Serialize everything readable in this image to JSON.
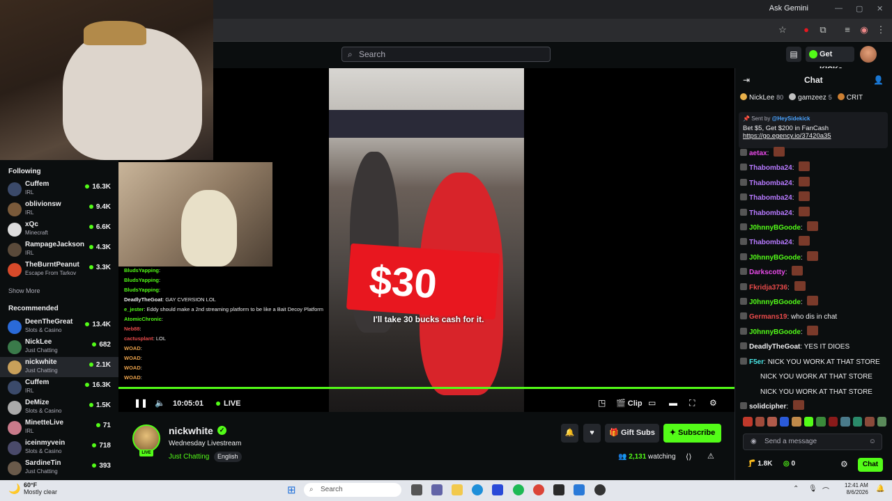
{
  "browser": {
    "ask_gemini": "Ask Gemini"
  },
  "header": {
    "search_placeholder": "Search",
    "get_kicks": "Get KICKs"
  },
  "sidebar": {
    "following_heading": "Following",
    "following": [
      {
        "name": "Cuffem",
        "category": "IRL",
        "viewers": "16.3K",
        "color": "#3b4a6a"
      },
      {
        "name": "oblivionsw",
        "category": "IRL",
        "viewers": "9.4K",
        "color": "#7a5a3a"
      },
      {
        "name": "xQc",
        "category": "Minecraft",
        "viewers": "6.6K",
        "color": "#ddd"
      },
      {
        "name": "RampageJackson",
        "category": "IRL",
        "viewers": "4.3K",
        "color": "#5a4a3a"
      },
      {
        "name": "TheBurntPeanut",
        "category": "Escape From Tarkov",
        "viewers": "3.3K",
        "color": "#d84a2a"
      }
    ],
    "show_more": "Show More",
    "recommended_heading": "Recommended",
    "recommended": [
      {
        "name": "DeenTheGreat",
        "category": "Slots & Casino",
        "viewers": "13.4K",
        "color": "#2a6ad8"
      },
      {
        "name": "NickLee",
        "category": "Just Chatting",
        "viewers": "682",
        "color": "#3a7a4a"
      },
      {
        "name": "nickwhite",
        "category": "Just Chatting",
        "viewers": "2.1K",
        "color": "#c9a05a"
      },
      {
        "name": "Cuffem",
        "category": "IRL",
        "viewers": "16.3K",
        "color": "#3b4a6a"
      },
      {
        "name": "DeMize",
        "category": "Slots & Casino",
        "viewers": "1.5K",
        "color": "#aaa"
      },
      {
        "name": "MinetteLive",
        "category": "IRL",
        "viewers": "71",
        "color": "#c97a8a"
      },
      {
        "name": "iceinmyvein",
        "category": "Slots & Casino",
        "viewers": "718",
        "color": "#4a4a6a"
      },
      {
        "name": "SardineTin",
        "category": "Just Chatting",
        "viewers": "393",
        "color": "#6a5a4a"
      }
    ]
  },
  "player": {
    "price": "$30",
    "caption": "I'll take 30 bucks cash for it.",
    "time": "10:05:01",
    "live": "LIVE",
    "clip": "Clip",
    "progress_fraction": 1.0,
    "overlay_chat": [
      {
        "user": "BludsYapping",
        "text": "",
        "color": "#53fc18"
      },
      {
        "user": "BludsYapping",
        "text": "",
        "color": "#53fc18"
      },
      {
        "user": "BludsYapping",
        "text": "",
        "color": "#53fc18"
      },
      {
        "user": "DeadlyTheGoat",
        "text": "GAY CVERSION LOL",
        "color": "#efeff1"
      },
      {
        "user": "e_jester",
        "text": "Eddy should make a 2nd streaming platform to be like a Bait Decoy Platform",
        "color": "#53fc18"
      },
      {
        "user": "AtomicChronic",
        "text": "",
        "color": "#53fc18"
      },
      {
        "user": "Neb88",
        "text": "",
        "color": "#e84a4a"
      },
      {
        "user": "cactusplant",
        "text": "LOL",
        "color": "#e84a4a"
      },
      {
        "user": "WOAD",
        "text": "",
        "color": "#e8a04a"
      },
      {
        "user": "WOAD",
        "text": "",
        "color": "#e8a04a"
      },
      {
        "user": "WOAD",
        "text": "",
        "color": "#e8a04a"
      },
      {
        "user": "WOAD",
        "text": "",
        "color": "#e8a04a"
      }
    ]
  },
  "stream": {
    "streamer": "nickwhite",
    "live_badge": "LIVE",
    "title": "Wednesday Livestream",
    "category": "Just Chatting",
    "language": "English",
    "gift_subs": "Gift Subs",
    "subscribe": "Subscribe",
    "watching_count": "2,131",
    "watching_label": "watching"
  },
  "chat": {
    "title": "Chat",
    "leaders": [
      {
        "name": "NickLee",
        "score": "80",
        "color": "#e8b04a"
      },
      {
        "name": "gamzeez",
        "score": "5",
        "color": "#c0c0c0"
      },
      {
        "name": "CRIT",
        "score": "",
        "color": "#cd7f32"
      }
    ],
    "pinned_sent_by": "Sent by",
    "pinned_sender": "@HeySidekick",
    "pinned_message": "Bet $5, Get $200 in FanCash",
    "pinned_link": "https://go.egency.io/37420a35",
    "messages": [
      {
        "user": "aetax",
        "text": "",
        "color": "#e84ae8"
      },
      {
        "user": "Thabomba24",
        "text": "",
        "color": "#b77aff"
      },
      {
        "user": "Thabomba24",
        "text": "",
        "color": "#b77aff"
      },
      {
        "user": "Thabomba24",
        "text": "",
        "color": "#b77aff"
      },
      {
        "user": "Thabomba24",
        "text": "",
        "color": "#b77aff"
      },
      {
        "user": "J0hnnyBGoode",
        "text": "",
        "color": "#53fc18"
      },
      {
        "user": "Thabomba24",
        "text": "",
        "color": "#b77aff"
      },
      {
        "user": "J0hnnyBGoode",
        "text": "",
        "color": "#53fc18"
      },
      {
        "user": "Darkscotty",
        "text": "",
        "color": "#e84ae8"
      },
      {
        "user": "Fkridja3736",
        "text": "",
        "color": "#e84a4a"
      },
      {
        "user": "J0hnnyBGoode",
        "text": "",
        "color": "#53fc18"
      },
      {
        "user": "Germans19",
        "text": "who dis in chat",
        "color": "#e84a4a"
      },
      {
        "user": "J0hnnyBGoode",
        "text": "",
        "color": "#53fc18"
      },
      {
        "user": "DeadlyTheGoat",
        "text": "YES IT DIOES",
        "color": "#efeff1"
      },
      {
        "user": "F5er",
        "text": "NICK YOU WORK AT THAT STORE",
        "color": "#4ae8e8"
      },
      {
        "user": "",
        "text": "NICK YOU WORK AT THAT STORE",
        "color": "#efeff1"
      },
      {
        "user": "",
        "text": "NICK YOU WORK AT THAT STORE",
        "color": "#efeff1"
      },
      {
        "user": "solidcipher",
        "text": "",
        "color": "#efeff1"
      }
    ],
    "input_placeholder": "Send a message",
    "kicks_count": "1.8K",
    "points_count": "0",
    "send_label": "Chat"
  },
  "taskbar": {
    "temp": "60°F",
    "weather": "Mostly clear",
    "search": "Search",
    "time": "12:41 AM",
    "date": "8/6/2026"
  }
}
